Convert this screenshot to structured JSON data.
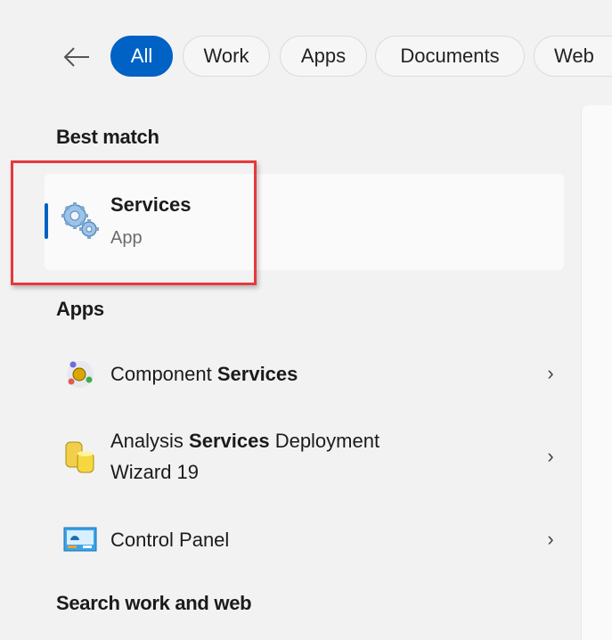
{
  "filters": {
    "back_icon": "arrow-left-icon",
    "tabs": [
      {
        "label": "All",
        "active": true
      },
      {
        "label": "Work",
        "active": false
      },
      {
        "label": "Apps",
        "active": false
      },
      {
        "label": "Documents",
        "active": false
      },
      {
        "label": "Web",
        "active": false
      }
    ]
  },
  "best_match": {
    "heading": "Best match",
    "item": {
      "title": "Services",
      "subtitle": "App",
      "icon": "services-gears-icon"
    }
  },
  "apps": {
    "heading": "Apps",
    "items": [
      {
        "segments": [
          {
            "text": "Component ",
            "bold": false
          },
          {
            "text": "Services",
            "bold": true
          }
        ],
        "icon": "component-services-icon",
        "chevron": "chevron-right-icon"
      },
      {
        "segments": [
          {
            "text": "Analysis ",
            "bold": false
          },
          {
            "text": "Services",
            "bold": true
          },
          {
            "text": " Deployment Wizard 19",
            "bold": false
          }
        ],
        "icon": "analysis-services-icon",
        "chevron": "chevron-right-icon"
      },
      {
        "segments": [
          {
            "text": "Control Panel",
            "bold": false
          }
        ],
        "icon": "control-panel-icon",
        "chevron": "chevron-right-icon"
      }
    ]
  },
  "search_web": {
    "heading": "Search work and web"
  },
  "colors": {
    "accent": "#0062c4",
    "highlight_box": "#e8383d"
  }
}
